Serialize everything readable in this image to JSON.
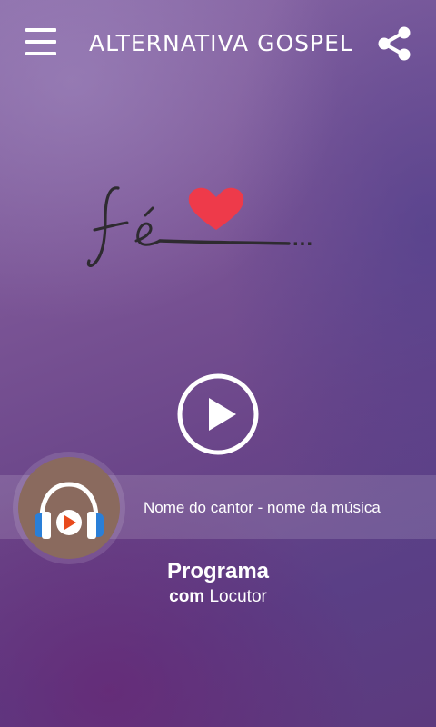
{
  "header": {
    "title": "ALTERNATIVA GOSPEL",
    "menu_icon": "hamburger-menu-icon",
    "share_icon": "share-icon"
  },
  "logo": {
    "text": "fé",
    "trailing": "...",
    "heart_color": "#ee3a4a"
  },
  "player": {
    "play_icon": "play-icon",
    "now_playing": "Nome do cantor - nome da música",
    "badge_icon": "headphones-icon"
  },
  "program": {
    "name": "Programa",
    "host_prefix": "com",
    "host_name": "Locutor"
  }
}
